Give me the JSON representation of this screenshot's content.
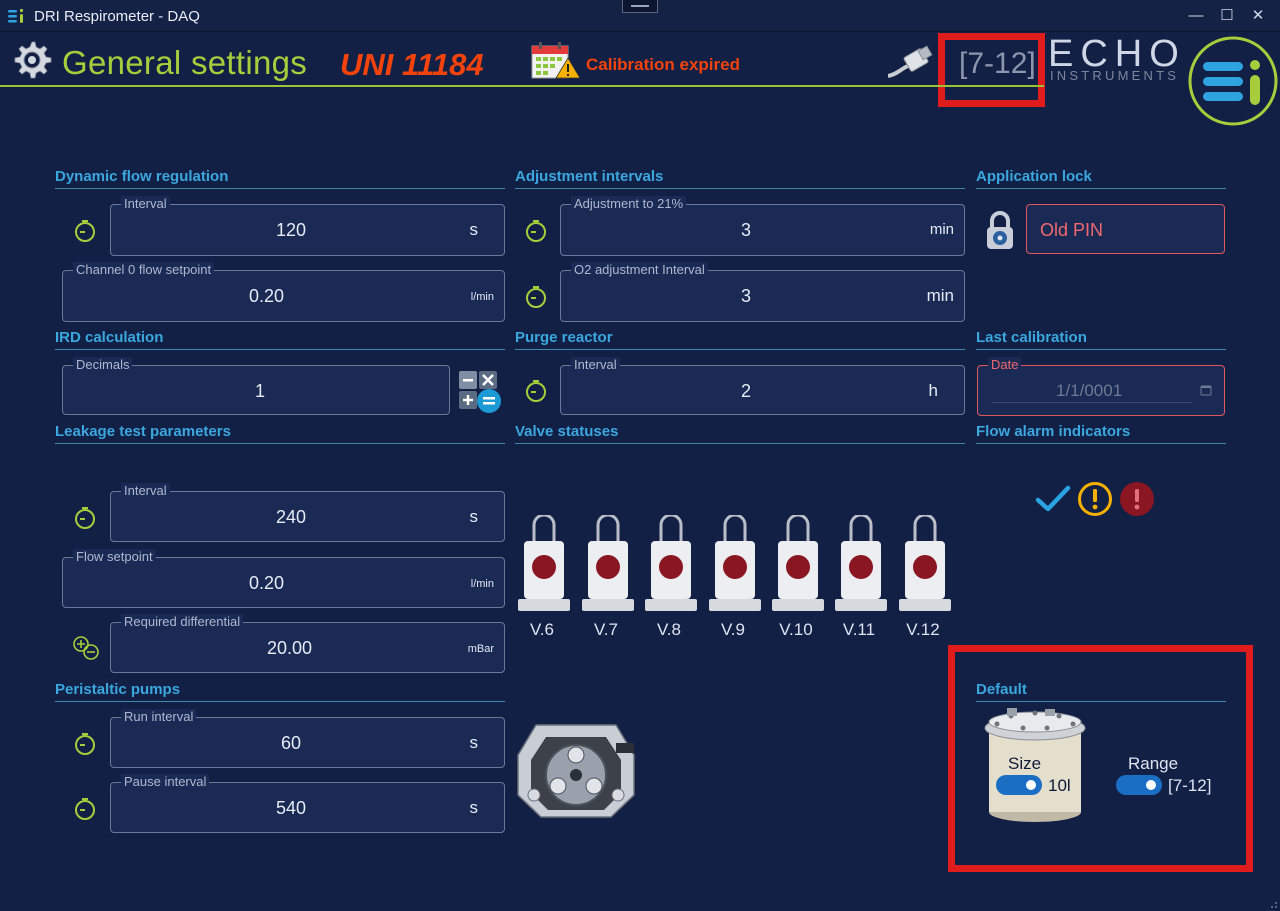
{
  "window": {
    "title": "DRI Respirometer - DAQ",
    "controls": {
      "minimize": "—",
      "maximize": "☐",
      "close": "✕"
    }
  },
  "header": {
    "page_title": "General settings",
    "standard": "UNI 11184",
    "calibration_status": "Calibration expired",
    "range": "[7-12]",
    "brand_top": "ECHO",
    "brand_bottom": "INSTRUMENTS"
  },
  "sections": {
    "dynamic_flow": "Dynamic flow regulation",
    "adjustment": "Adjustment intervals",
    "app_lock": "Application lock",
    "ird": "IRD calculation",
    "purge": "Purge reactor",
    "last_cal": "Last calibration",
    "leakage": "Leakage test parameters",
    "valves": "Valve statuses",
    "flow_alarm": "Flow alarm indicators",
    "pumps": "Peristaltic pumps",
    "default": "Default"
  },
  "dynamic_flow": {
    "interval": {
      "label": "Interval",
      "value": "120",
      "unit": "s"
    },
    "channel0": {
      "label": "Channel 0 flow setpoint",
      "value": "0.20",
      "unit": "l/min"
    }
  },
  "adjustment": {
    "adj21": {
      "label": "Adjustment to 21%",
      "value": "3",
      "unit": "min"
    },
    "o2": {
      "label": "O2 adjustment Interval",
      "value": "3",
      "unit": "min"
    }
  },
  "app_lock": {
    "placeholder": "Old PIN"
  },
  "ird": {
    "decimals": {
      "label": "Decimals",
      "value": "1"
    }
  },
  "purge": {
    "interval": {
      "label": "Interval",
      "value": "2",
      "unit": "h"
    }
  },
  "last_cal": {
    "label": "Date",
    "value": "1/1/0001"
  },
  "leakage": {
    "interval": {
      "label": "Interval",
      "value": "240",
      "unit": "s"
    },
    "flow": {
      "label": "Flow setpoint",
      "value": "0.20",
      "unit": "l/min"
    },
    "diff": {
      "label": "Required differential",
      "value": "20.00",
      "unit": "mBar"
    }
  },
  "valves": [
    "V.6",
    "V.7",
    "V.8",
    "V.9",
    "V.10",
    "V.11",
    "V.12"
  ],
  "pumps": {
    "run": {
      "label": "Run interval",
      "value": "60",
      "unit": "s"
    },
    "pause": {
      "label": "Pause interval",
      "value": "540",
      "unit": "s"
    }
  },
  "default": {
    "size_label": "Size",
    "size_value": "10l",
    "range_label": "Range",
    "range_value": "[7-12]"
  },
  "colors": {
    "background": "#132045",
    "accent_green": "#a8cd3c",
    "section_blue": "#3aa7df",
    "alert_red": "#f2430d",
    "highlight_red": "#e01c1c",
    "toggle_on": "#1a6fc5"
  }
}
